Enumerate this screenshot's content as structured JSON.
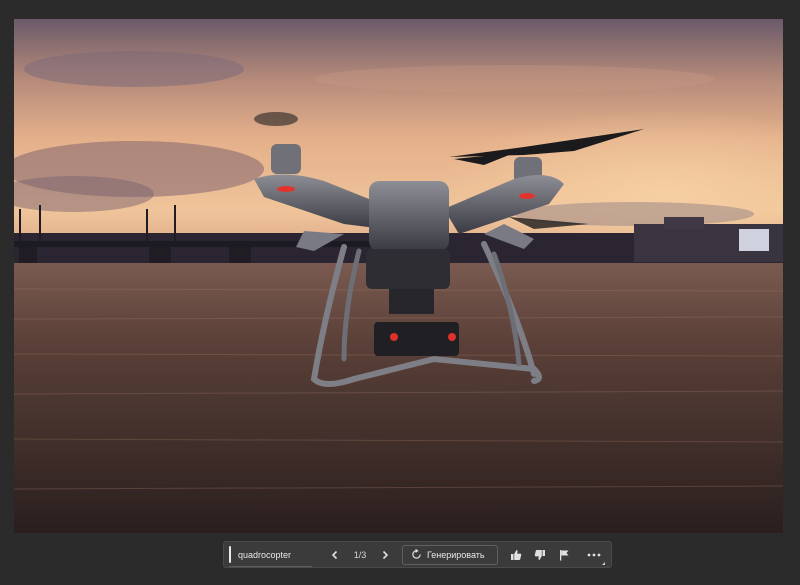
{
  "canvas": {
    "image_subject": "drone-over-river-at-sunset"
  },
  "toolbar": {
    "prompt_value": "quadrocopter",
    "counter": "1/3",
    "generate_label": "Генерировать",
    "icons": {
      "prev": "chevron-left-icon",
      "next": "chevron-right-icon",
      "generate": "refresh-icon",
      "like": "thumbs-up-icon",
      "dislike": "thumbs-down-icon",
      "report": "flag-icon",
      "more": "more-icon"
    }
  },
  "colors": {
    "app_background": "#2b2b2b",
    "toolbar_background": "#3b3b3b",
    "text": "#e8e8e8"
  }
}
